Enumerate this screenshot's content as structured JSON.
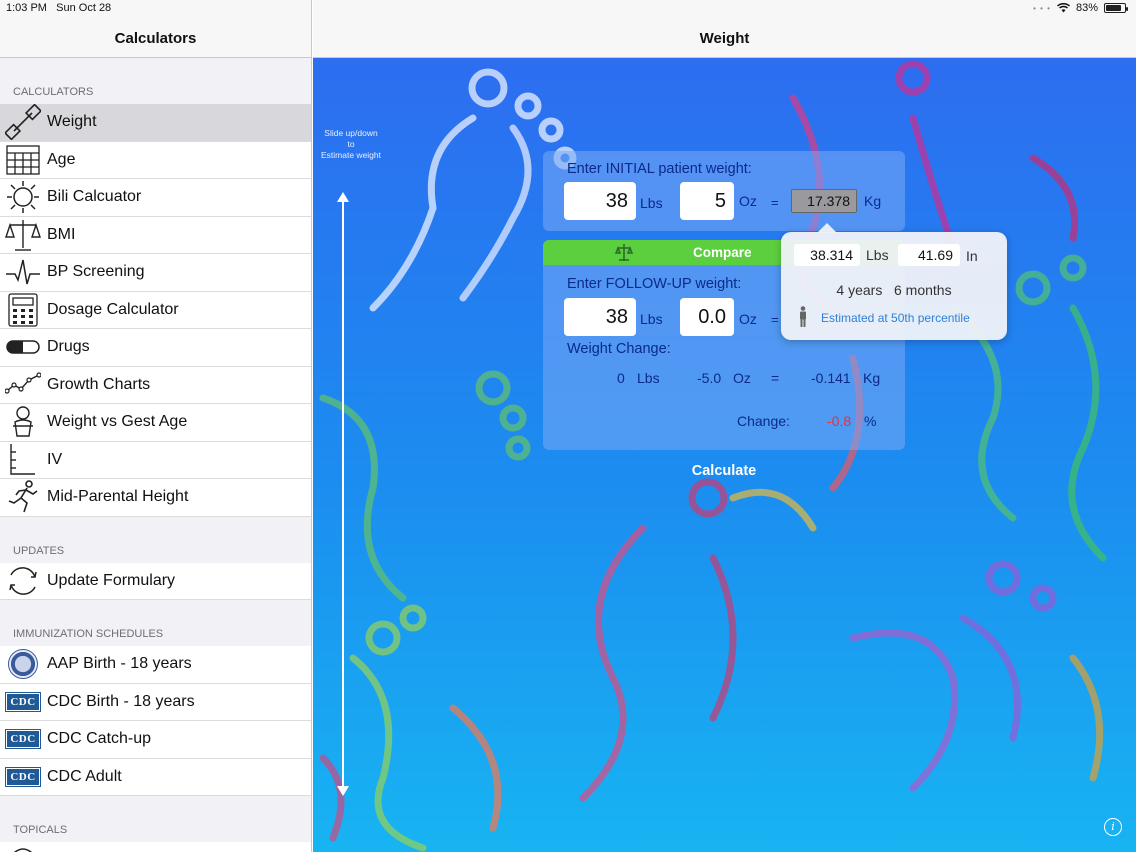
{
  "status": {
    "time": "1:03 PM",
    "date": "Sun Oct 28",
    "battery": "83%",
    "battery_level": 0.83
  },
  "sidebar": {
    "title": "Calculators",
    "sections": {
      "calculators": {
        "label": "CALCULATORS",
        "items": [
          {
            "label": "Weight",
            "icon": "dumbbell-icon"
          },
          {
            "label": "Age",
            "icon": "calendar-icon"
          },
          {
            "label": "Bili Calcuator",
            "icon": "sun-icon"
          },
          {
            "label": "BMI",
            "icon": "scale-icon"
          },
          {
            "label": "BP Screening",
            "icon": "pulse-icon"
          },
          {
            "label": "Dosage Calculator",
            "icon": "calculator-icon"
          },
          {
            "label": "Drugs",
            "icon": "pill-icon"
          },
          {
            "label": "Growth Charts",
            "icon": "line-chart-icon"
          },
          {
            "label": "Weight vs Gest Age",
            "icon": "baby-icon"
          },
          {
            "label": "IV",
            "icon": "iv-bag-icon"
          },
          {
            "label": "Mid-Parental Height",
            "icon": "running-figure-icon"
          }
        ]
      },
      "updates": {
        "label": "UPDATES",
        "items": [
          {
            "label": "Update Formulary",
            "icon": "refresh-icon"
          }
        ]
      },
      "immunization": {
        "label": "IMMUNIZATION SCHEDULES",
        "items": [
          {
            "label": "AAP Birth - 18 years",
            "icon": "aap-seal-icon"
          },
          {
            "label": "CDC Birth - 18 years",
            "icon": "cdc-logo-icon",
            "badge": "CDC"
          },
          {
            "label": "CDC Catch-up",
            "icon": "cdc-logo-icon",
            "badge": "CDC"
          },
          {
            "label": "CDC Adult",
            "icon": "cdc-logo-icon",
            "badge": "CDC"
          }
        ]
      },
      "topicals": {
        "label": "TOPICALS"
      }
    }
  },
  "main": {
    "title": "Weight",
    "slide_hint": [
      "Slide up/down",
      "to",
      "Estimate weight"
    ],
    "initial": {
      "title": "Enter INITIAL patient weight:",
      "lbs": "38",
      "lbs_unit": "Lbs",
      "oz": "5",
      "oz_unit": "Oz",
      "eq": "=",
      "kg": "17.378",
      "kg_unit": "Kg"
    },
    "compare_label": "Compare",
    "followup": {
      "title": "Enter FOLLOW-UP weight:",
      "lbs": "38",
      "lbs_unit": "Lbs",
      "oz": "0.0",
      "oz_unit": "Oz",
      "eq": "="
    },
    "change": {
      "title": "Weight Change:",
      "lbs": "0",
      "lbs_unit": "Lbs",
      "oz": "-5.0",
      "oz_unit": "Oz",
      "eq": "=",
      "kg": "-0.141",
      "kg_unit": "Kg",
      "label": "Change:",
      "percent": "-0.8",
      "percent_unit": "%"
    },
    "calculate_label": "Calculate",
    "popover": {
      "lbs": "38.314",
      "lbs_unit": "Lbs",
      "inches": "41.69",
      "inches_unit": "In",
      "age_years": "4 years",
      "age_months": "6 months",
      "estimate": "Estimated at 50th percentile"
    },
    "info_label": "i"
  }
}
